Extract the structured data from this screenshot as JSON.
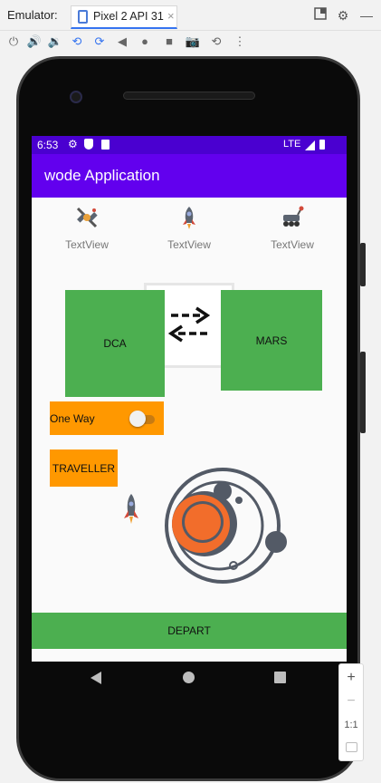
{
  "emulator": {
    "title": "Emulator:",
    "tab_label": "Pixel 2 API 31",
    "tab_close": "×",
    "toolbar_icons": [
      "power-icon",
      "volume-up-icon",
      "volume-down-icon",
      "rotate-left-icon",
      "rotate-right-icon",
      "back-icon",
      "home-icon",
      "overview-icon",
      "screenshot-icon",
      "snapshot-icon",
      "more-icon"
    ]
  },
  "status": {
    "time": "6:53",
    "network": "LTE"
  },
  "app": {
    "title": "wode Application"
  },
  "textviews": [
    {
      "icon": "satellite-icon",
      "label": "TextView"
    },
    {
      "icon": "rocket-icon",
      "label": "TextView"
    },
    {
      "icon": "rover-icon",
      "label": "TextView"
    }
  ],
  "route": {
    "from": "DCA",
    "to": "MARS"
  },
  "one_way": {
    "label": "One Way",
    "checked": false
  },
  "traveller_button": "TRAVELLER",
  "depart_button": "DEPART",
  "zoom": {
    "zoom_in": "+",
    "zoom_out": "−",
    "actual_size": "1:1"
  },
  "colors": {
    "app_bar": "#6200ee",
    "status_bar": "#4a00d0",
    "green": "#4caf50",
    "orange": "#ff9800"
  }
}
